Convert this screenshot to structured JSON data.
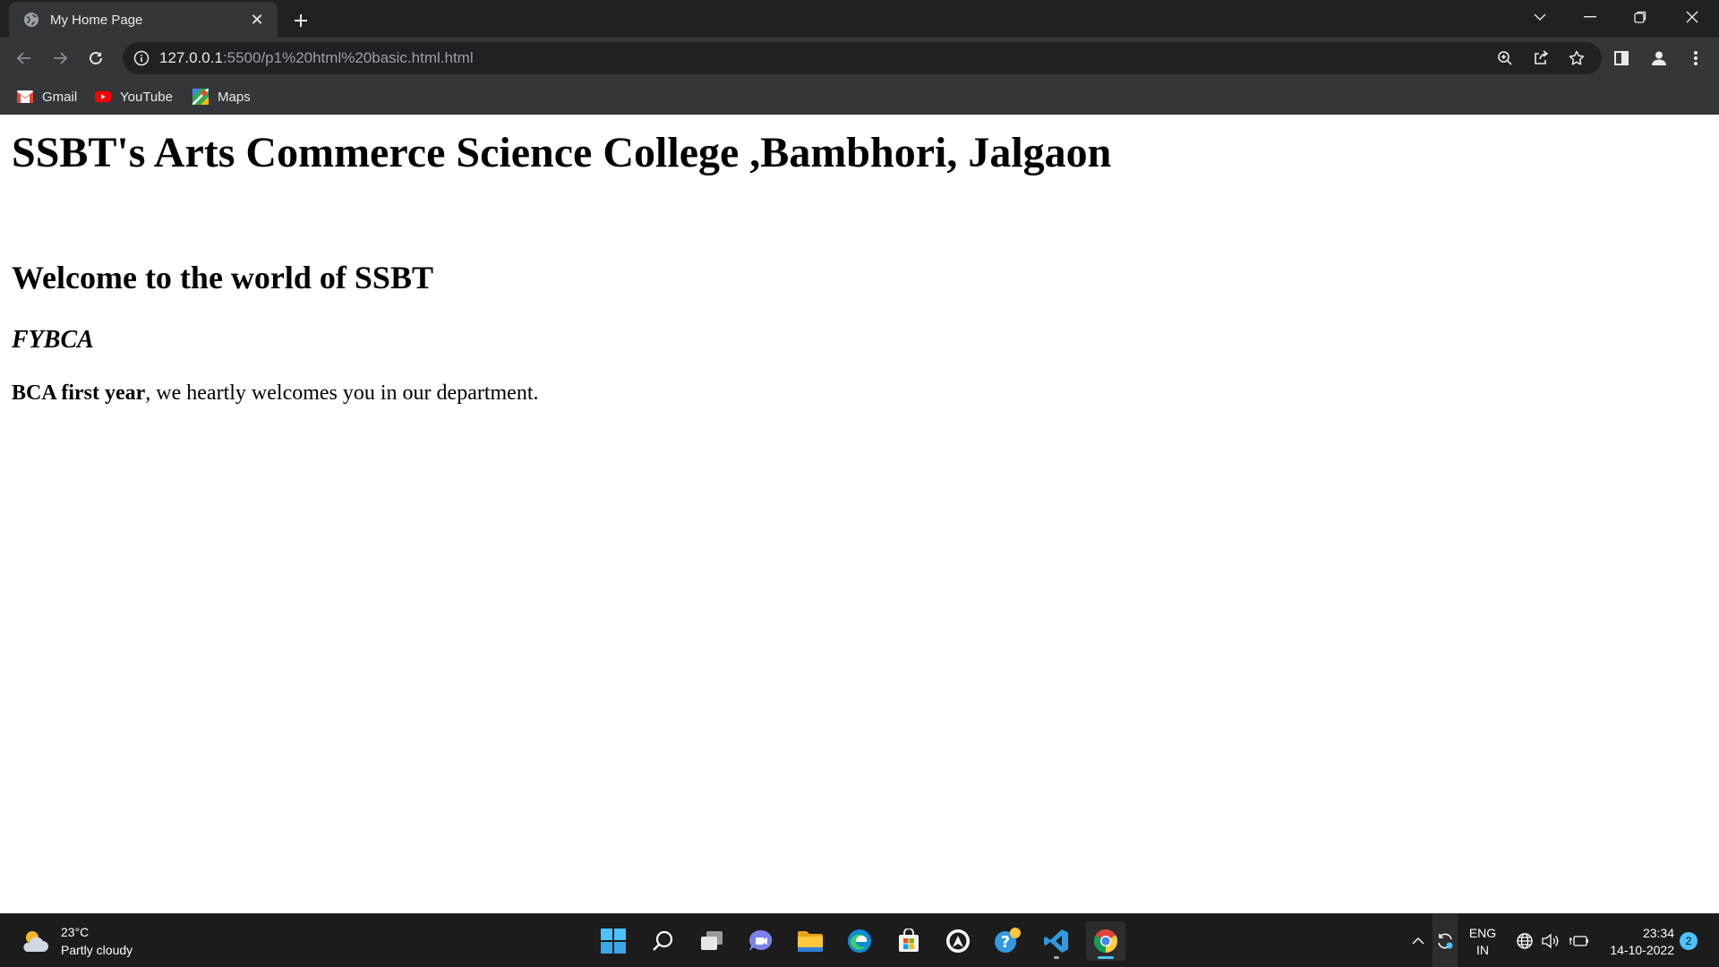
{
  "browser": {
    "tab": {
      "title": "My Home Page",
      "close_glyph": "✕"
    },
    "new_tab_glyph": "+",
    "address_bar": {
      "host": "127.0.0.1",
      "path": ":5500/p1%20html%20basic.html.html"
    },
    "bookmarks": [
      {
        "label": "Gmail",
        "icon": "gmail-icon"
      },
      {
        "label": "YouTube",
        "icon": "youtube-icon"
      },
      {
        "label": "Maps",
        "icon": "maps-icon"
      }
    ]
  },
  "page": {
    "heading1": "SSBT's Arts Commerce Science College ,Bambhori, Jalgaon",
    "heading2": "Welcome to the world of SSBT",
    "heading3": "FYBCA",
    "paragraph_bold": "BCA first year",
    "paragraph_rest": ", we heartly welcomes you in our department."
  },
  "taskbar": {
    "weather": {
      "temperature": "23°C",
      "condition": "Partly cloudy"
    },
    "language": {
      "line1": "ENG",
      "line2": "IN"
    },
    "clock": {
      "time": "23:34",
      "date": "14-10-2022"
    },
    "notifications_count": "2"
  },
  "colors": {
    "chrome_dark": "#202124",
    "chrome_toolbar": "#35363a",
    "taskbar": "#1c1c1c",
    "accent": "#4cc2ff"
  }
}
